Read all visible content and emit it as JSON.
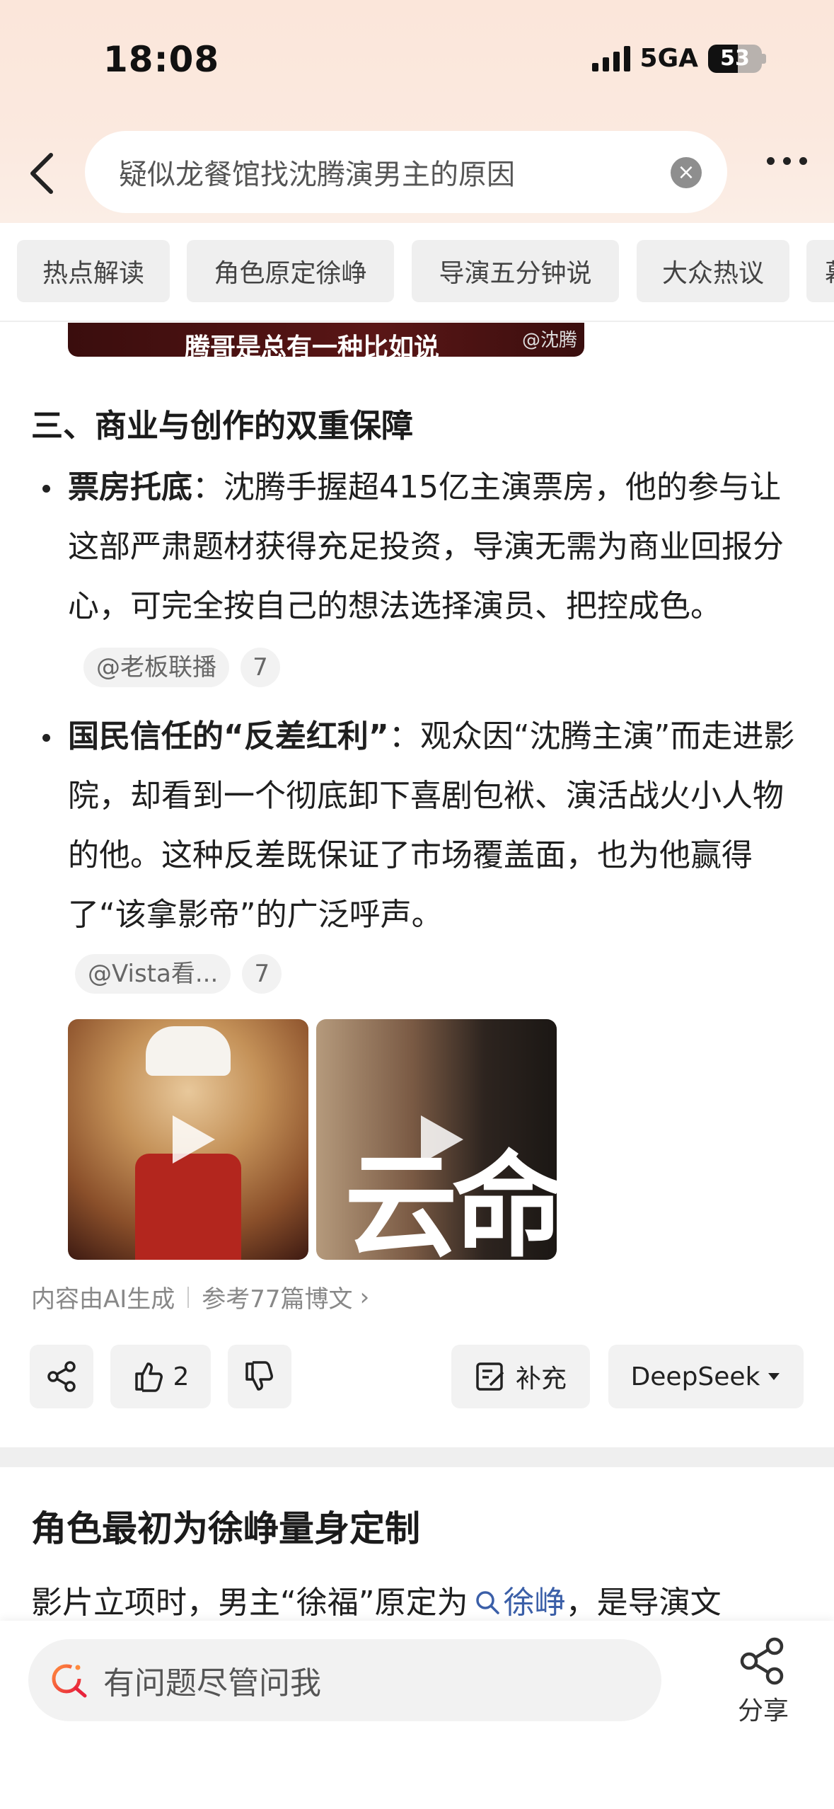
{
  "status": {
    "time": "18:08",
    "network": "5GA",
    "battery": "53"
  },
  "search": {
    "query": "疑似龙餐馆找沈腾演男主的原因"
  },
  "tabs": [
    "热点解读",
    "角色原定徐峥",
    "导演五分钟说",
    "大众热议",
    "幕"
  ],
  "video_strip": {
    "caption": "腾哥是总有一种比如说",
    "logo": "@沈腾"
  },
  "section": {
    "title": "三、商业与创作的双重保障",
    "bullets": [
      {
        "label": "票房托底",
        "text": "：沈腾手握超415亿主演票房，他的参与让这部严肃题材获得充足投资，导演无需为商业回报分心，可完全按自己的想法选择演员、把控成色。",
        "cite": "@老板联播",
        "cite_count": "7"
      },
      {
        "label": "国民信任的“反差红利”",
        "text": "：观众因“沈腾主演”而走进影院，却看到一个彻底卸下喜剧包袱、演活战火小人物的他。这种反差既保证了市场覆盖面，也为他赢得了“该拿影帝”的广泛呼声。",
        "cite": "@Vista看...",
        "cite_count": "7"
      }
    ]
  },
  "video_overlay_text": "云命",
  "ai_note": {
    "generated": "内容由AI生成",
    "refs": "参考77篇博文"
  },
  "actions": {
    "like_count": "2",
    "supplement": "补充",
    "model": "DeepSeek"
  },
  "section2": {
    "title": "角色最初为徐峥量身定制",
    "text_before": "影片立项时，男主“徐福”原定为",
    "link": "徐峥",
    "text_after": "，是导演文"
  },
  "bottom": {
    "ask_placeholder": "有问题尽管问我",
    "share": "分享"
  }
}
